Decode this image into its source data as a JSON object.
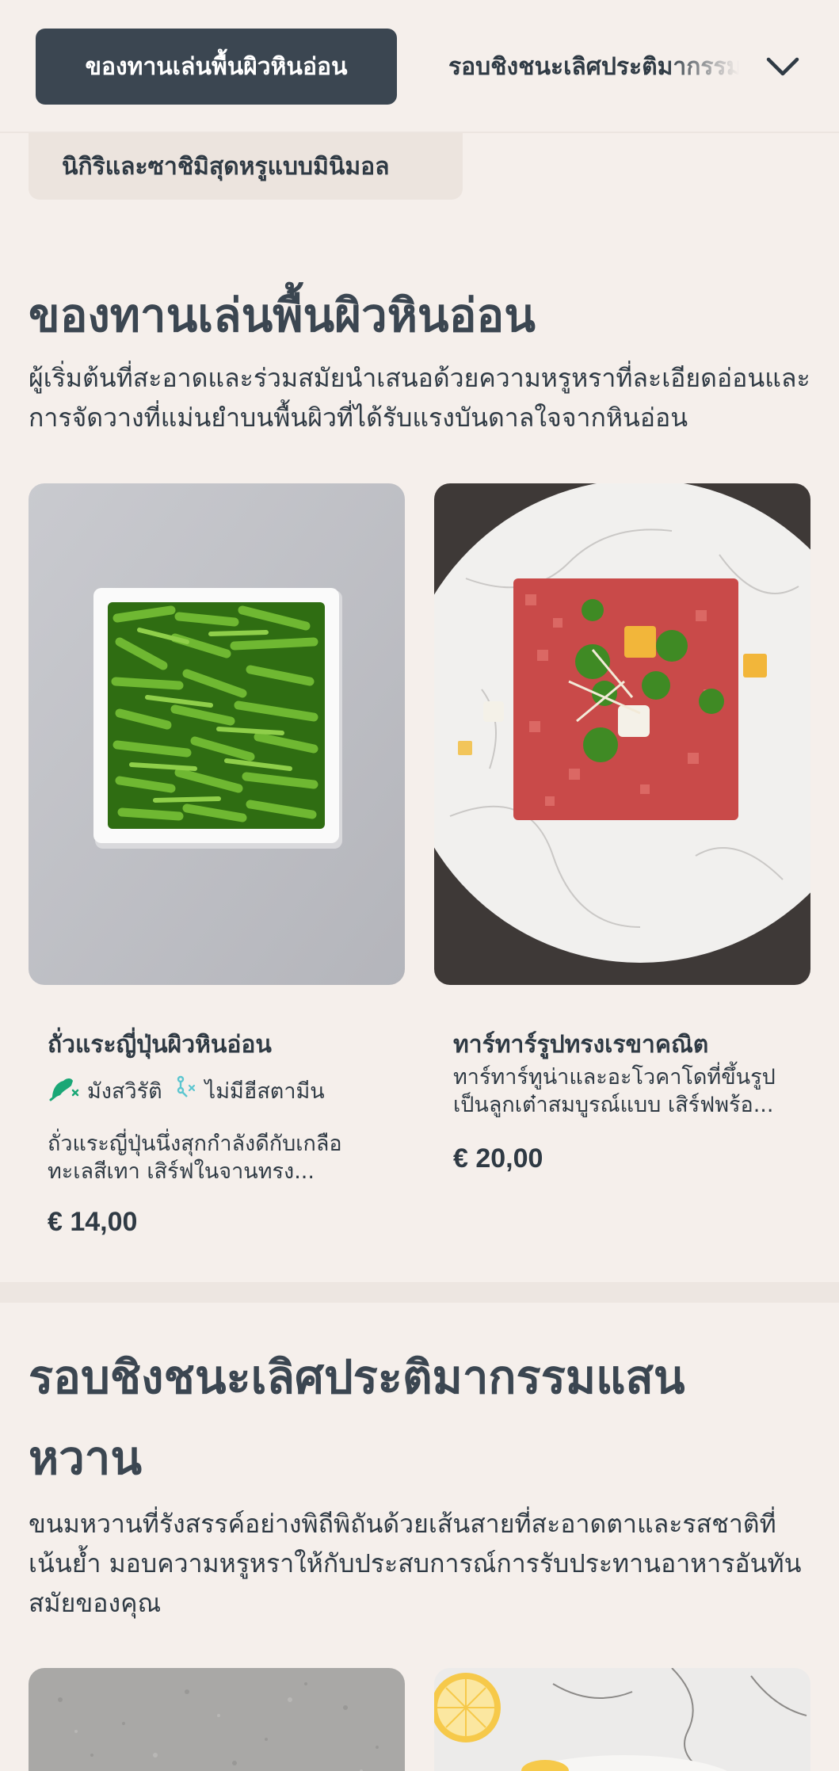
{
  "nav": {
    "active_label": "ของทานเล่นพื้นผิวหินอ่อน",
    "next_label": "รอบชิงชนะเลิศประติมากรรมแสนหวาน",
    "sub_label": "นิกิริและซาชิมิสุดหรูแบบมินิมอล"
  },
  "section1": {
    "title": "ของทานเล่นพื้นผิวหินอ่อน",
    "desc": "ผู้เริ่มต้นที่สะอาดและร่วมสมัยนำเสนอด้วยความหรูหราที่ละเอียดอ่อนและการจัดวางที่แม่นยำบนพื้นผิวที่ได้รับแรงบันดาลใจจากหินอ่อน",
    "items": [
      {
        "title": "ถั่วแระญี่ปุ่นผิวหินอ่อน",
        "tags": [
          "มังสวิรัติ",
          "ไม่มีฮีสตามีน"
        ],
        "desc": "ถั่วแระญี่ปุ่นนึ่งสุกกำลังดีกับเกลือทะเลสีเทา เสิร์ฟในจานทรง...",
        "price": "€ 14,00"
      },
      {
        "title": "ทาร์ทาร์รูปทรงเรขาคณิต",
        "desc": "ทาร์ทาร์ทูน่าและอะโวคาโดที่ขึ้นรูปเป็นลูกเต๋าสมบูรณ์แบบ เสิร์ฟพร้อ...",
        "price": "€ 20,00"
      }
    ]
  },
  "section2": {
    "title_line1": "รอบชิงชนะเลิศประติมากรรมแสน",
    "title_line2": "หวาน",
    "desc": "ขนมหวานที่รังสรรค์อย่างพิถีพิถันด้วยเส้นสายที่สะอาดตาและรสชาติที่เน้นย้ำ มอบความหรูหราให้กับประสบการณ์การรับประทานอาหารอันทันสมัยของคุณ"
  },
  "colors": {
    "background": "#f5efeb",
    "active_pill": "#3b4651",
    "text": "#2f3a44",
    "vegan_icon": "#1aa776",
    "histamine_icon": "#5cc6d0"
  }
}
